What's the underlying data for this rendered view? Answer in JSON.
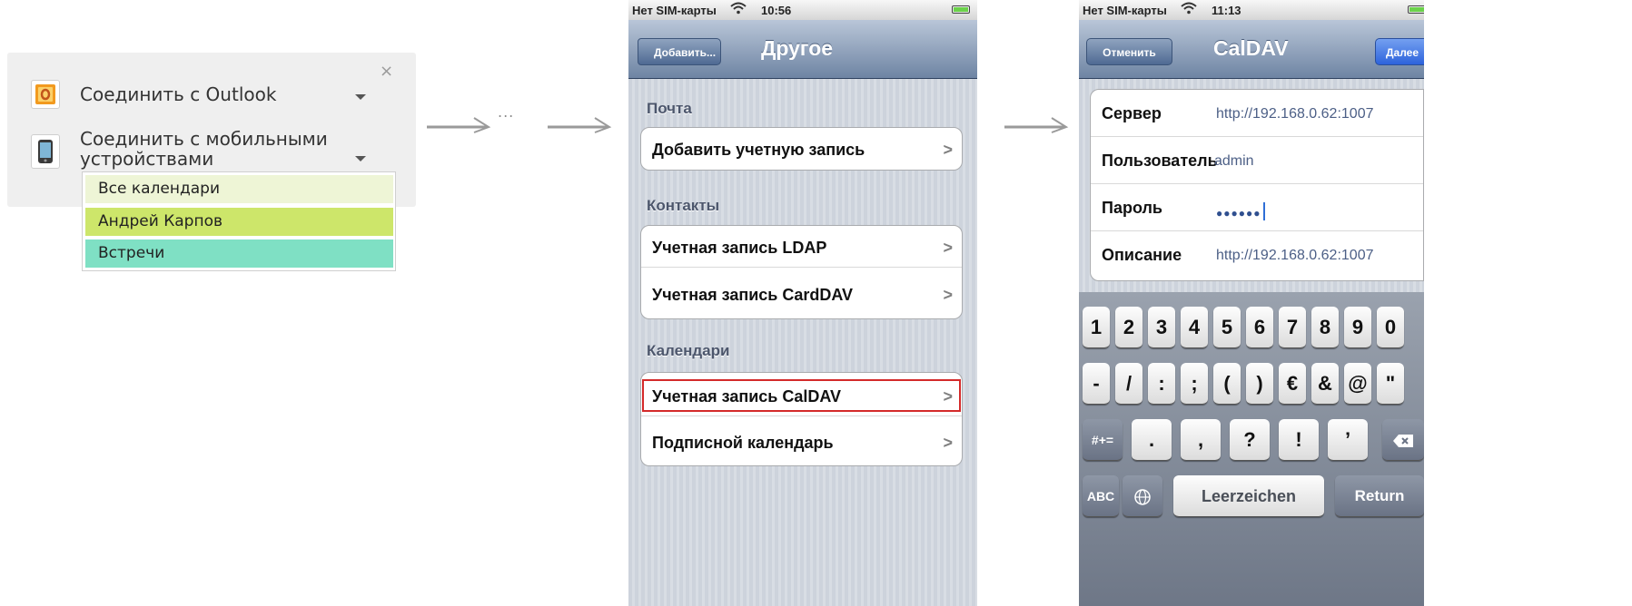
{
  "left_panel": {
    "close_glyph": "×",
    "outlook": {
      "icon": "outlook-icon",
      "label": "Соединить с Outlook"
    },
    "mobile": {
      "icon": "mobile-phone-icon",
      "label_line1": "Соединить с мобильными",
      "label_line2": "устройствами"
    },
    "calendars": [
      {
        "label": "Все календари",
        "color": "#eef5d6"
      },
      {
        "label": "Андрей Карпов",
        "color": "#cde66a"
      },
      {
        "label": "Встречи",
        "color": "#7fe0c4"
      }
    ]
  },
  "ellipsis": "...",
  "phone1": {
    "status": {
      "carrier": "Нет SIM-карты",
      "time": "10:56"
    },
    "back_button": "Добавить...",
    "title": "Другое",
    "sections": [
      {
        "header": "Почта",
        "items": [
          "Добавить учетную запись"
        ]
      },
      {
        "header": "Контакты",
        "items": [
          "Учетная запись LDAP",
          "Учетная запись CardDAV"
        ]
      },
      {
        "header": "Календари",
        "items": [
          "Учетная запись CalDAV",
          "Подписной календарь"
        ]
      }
    ],
    "highlighted_item": "Учетная запись CalDAV",
    "highlight_color": "#d42a2a"
  },
  "phone2": {
    "status": {
      "carrier": "Нет SIM-карты",
      "time": "11:13"
    },
    "cancel_button": "Отменить",
    "title": "CalDAV",
    "next_button": "Далее",
    "fields": [
      {
        "label": "Сервер",
        "value": "http://192.168.0.62:1007"
      },
      {
        "label": "Пользователь",
        "value": "admin"
      },
      {
        "label": "Пароль",
        "value": "●●●●●●"
      },
      {
        "label": "Описание",
        "value": "http://192.168.0.62:1007"
      }
    ],
    "keyboard": {
      "row1": [
        "1",
        "2",
        "3",
        "4",
        "5",
        "6",
        "7",
        "8",
        "9",
        "0"
      ],
      "row2": [
        "-",
        "/",
        ":",
        ";",
        "(",
        ")",
        "€",
        "&",
        "@",
        "\""
      ],
      "row3_left": "#+=",
      "row3": [
        ".",
        ",",
        "?",
        "!",
        "’"
      ],
      "backspace_icon": "backspace-icon",
      "abc": "ABC",
      "globe_icon": "globe-icon",
      "space": "Leerzeichen",
      "return": "Return"
    }
  }
}
